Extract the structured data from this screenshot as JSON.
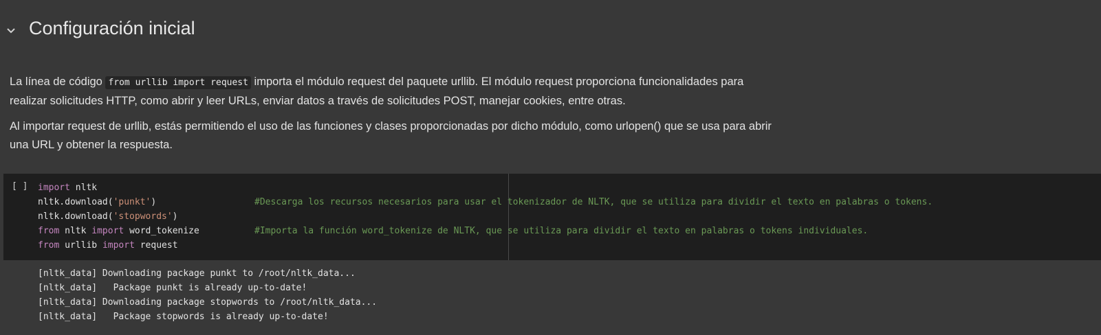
{
  "section": {
    "title": "Configuración inicial",
    "toggle_icon": "chevron-down-icon"
  },
  "text": {
    "p1_before": "La línea de código ",
    "p1_code": "from urllib import request",
    "p1_after": " importa el módulo request del paquete urllib. El módulo request proporciona funcionalidades para realizar solicitudes HTTP, como abrir y leer URLs, enviar datos a través de solicitudes POST, manejar cookies, entre otras.",
    "p2": "Al importar request de urllib, estás permitiendo el uso de las funciones y clases proporcionadas por dicho módulo, como urlopen() que se usa para abrir una URL y obtener la respuesta."
  },
  "code_cell": {
    "run_indicator": "[ ]",
    "lines": [
      {
        "kw": "import",
        "rest": " nltk"
      },
      {
        "pre": "nltk.download(",
        "str": "'punkt'",
        "post": ")",
        "comment": "#Descarga los recursos necesarios para usar el tokenizador de NLTK, que se utiliza para dividir el texto en palabras o tokens."
      },
      {
        "pre": "nltk.download(",
        "str": "'stopwords'",
        "post": ")"
      },
      {
        "kw": "from",
        "mid": " nltk ",
        "kw2": "import",
        "rest": " word_tokenize",
        "comment": "#Importa la función word_tokenize de NLTK, que se utiliza para dividir el texto en palabras o tokens individuales."
      },
      {
        "kw": "from",
        "mid": " urllib ",
        "kw2": "import",
        "rest": " request"
      }
    ]
  },
  "output": [
    "[nltk_data] Downloading package punkt to /root/nltk_data...",
    "[nltk_data]   Package punkt is already up-to-date!",
    "[nltk_data] Downloading package stopwords to /root/nltk_data...",
    "[nltk_data]   Package stopwords is already up-to-date!"
  ],
  "colors": {
    "background": "#383838",
    "code_background": "#1e1e1e",
    "keyword": "#c586c0",
    "string": "#ce9178",
    "comment": "#6a9955"
  }
}
